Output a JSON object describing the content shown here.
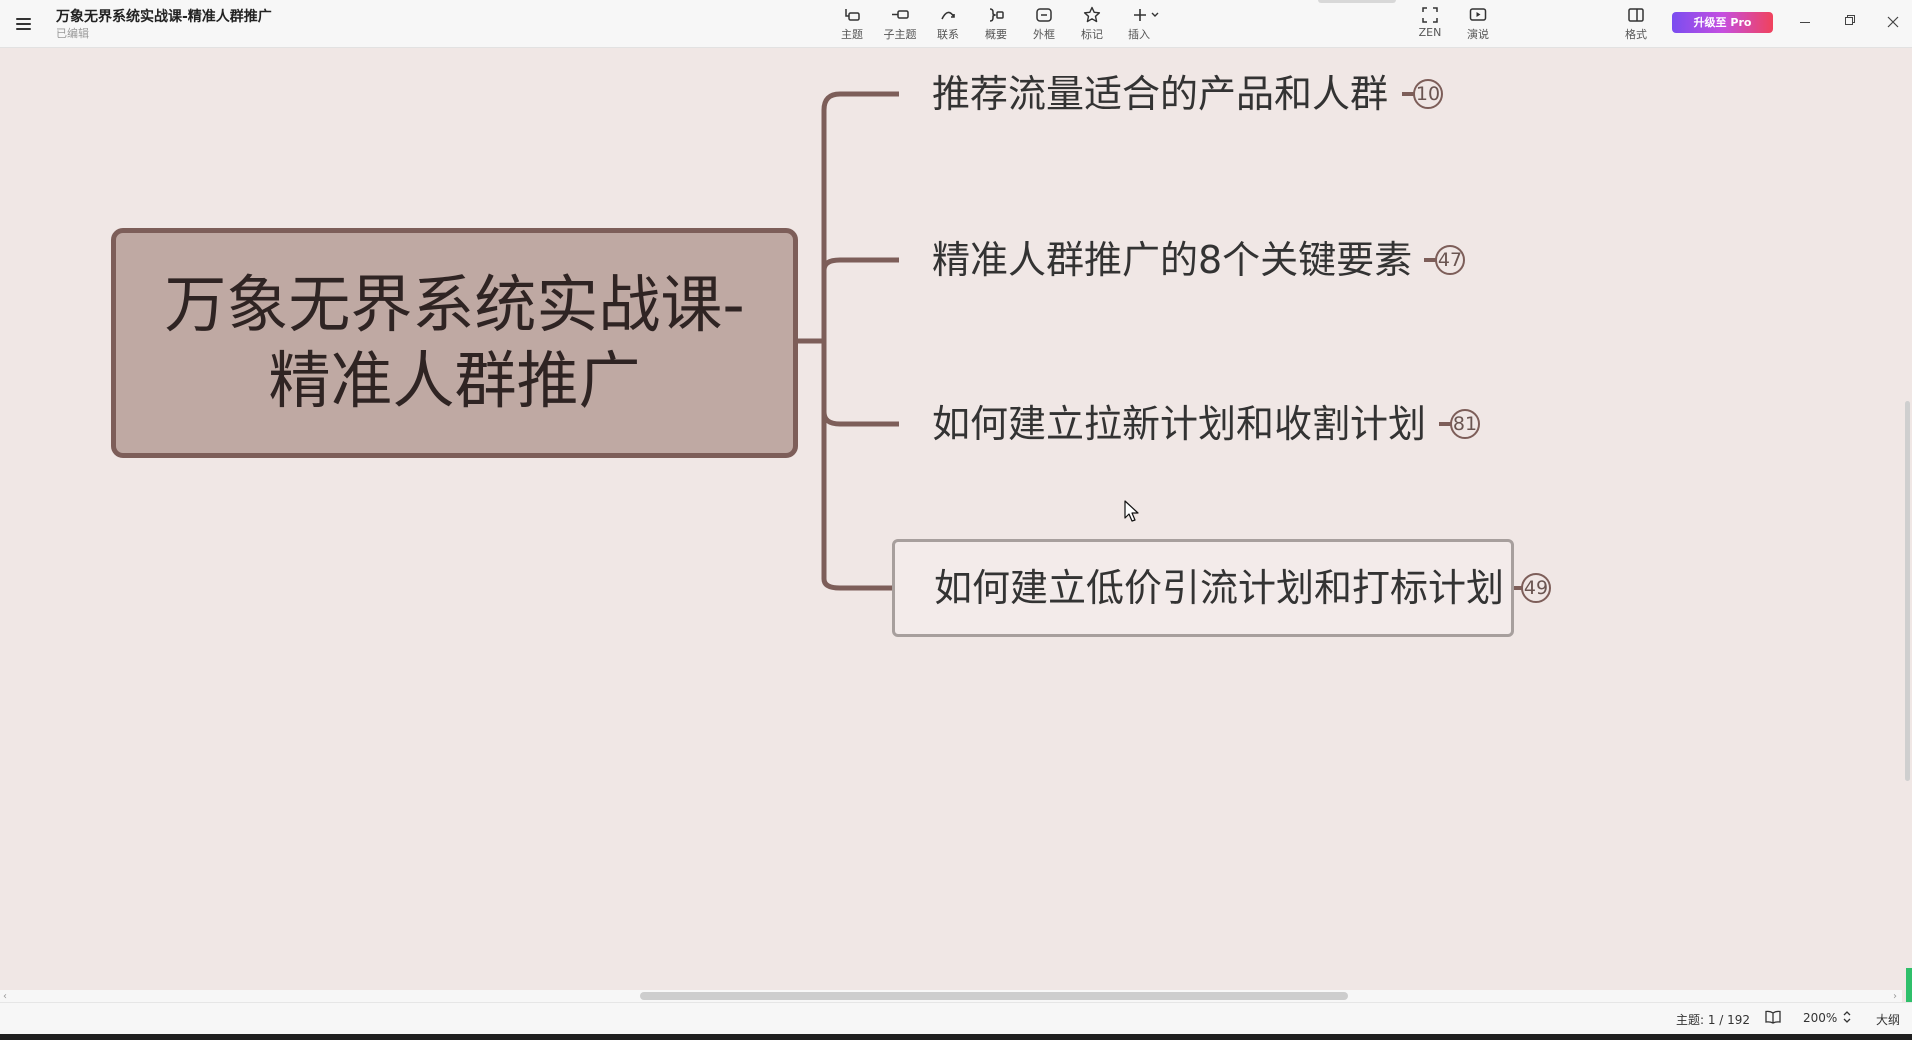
{
  "document": {
    "title": "万象无界系统实战课-精准人群推广",
    "status": "已编辑"
  },
  "toolbar": {
    "items": [
      {
        "label": "主题",
        "icon": "topic-icon"
      },
      {
        "label": "子主题",
        "icon": "subtopic-icon"
      },
      {
        "label": "联系",
        "icon": "relationship-icon"
      },
      {
        "label": "概要",
        "icon": "summary-icon"
      },
      {
        "label": "外框",
        "icon": "boundary-icon"
      },
      {
        "label": "标记",
        "icon": "star-icon"
      },
      {
        "label": "插入",
        "icon": "plus-icon"
      },
      {
        "label": "ZEN",
        "icon": "fullscreen-icon"
      },
      {
        "label": "演说",
        "icon": "presentation-icon"
      },
      {
        "label": "格式",
        "icon": "format-panel-icon"
      }
    ],
    "upgrade_label": "升级至 Pro"
  },
  "mindmap": {
    "central_topic": [
      "万象无界系统实战课-",
      "精准人群推广"
    ],
    "line_color": "#7d5e59",
    "central_fill": "#bfa9a3",
    "subtopics": [
      {
        "label": "推荐流量适合的产品和人群",
        "count": "10"
      },
      {
        "label": "精准人群推广的8个关键要素",
        "count": "47"
      },
      {
        "label": "如何建立拉新计划和收割计划",
        "count": "81"
      },
      {
        "label": "如何建立低价引流计划和打标计划",
        "count": "49",
        "selected": true
      }
    ]
  },
  "statusbar": {
    "topic_count": "主题: 1 / 192",
    "zoom": "200%",
    "outline_label": "大纲"
  }
}
